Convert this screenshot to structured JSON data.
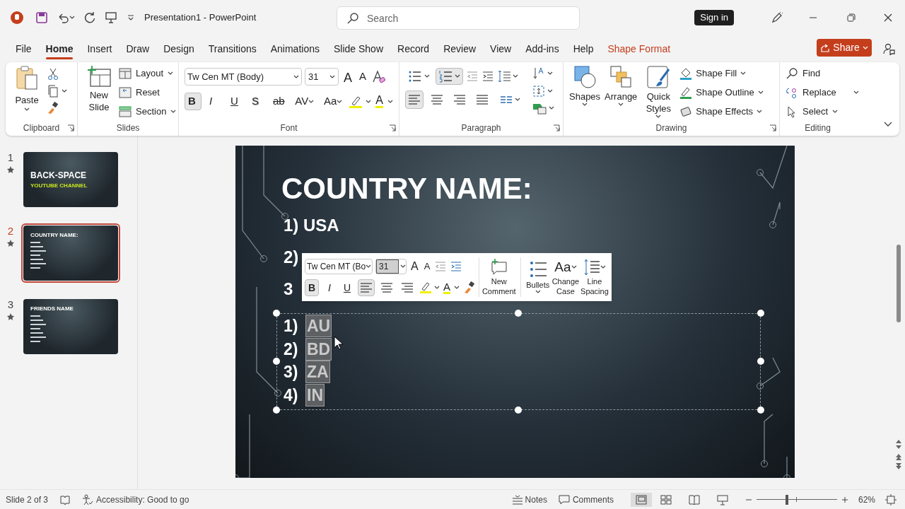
{
  "title_bar": {
    "document_title": "Presentation1  -  PowerPoint",
    "search": {
      "placeholder": "Search"
    },
    "sign_in": "Sign in"
  },
  "menu_tabs": [
    {
      "label": "File",
      "selected": false,
      "kind": "normal"
    },
    {
      "label": "Home",
      "selected": true,
      "kind": "normal"
    },
    {
      "label": "Insert",
      "selected": false,
      "kind": "normal"
    },
    {
      "label": "Draw",
      "selected": false,
      "kind": "normal"
    },
    {
      "label": "Design",
      "selected": false,
      "kind": "normal"
    },
    {
      "label": "Transitions",
      "selected": false,
      "kind": "normal"
    },
    {
      "label": "Animations",
      "selected": false,
      "kind": "normal"
    },
    {
      "label": "Slide Show",
      "selected": false,
      "kind": "normal"
    },
    {
      "label": "Record",
      "selected": false,
      "kind": "normal"
    },
    {
      "label": "Review",
      "selected": false,
      "kind": "normal"
    },
    {
      "label": "View",
      "selected": false,
      "kind": "normal"
    },
    {
      "label": "Add-ins",
      "selected": false,
      "kind": "normal"
    },
    {
      "label": "Help",
      "selected": false,
      "kind": "normal"
    },
    {
      "label": "Shape Format",
      "selected": false,
      "kind": "contextual"
    }
  ],
  "share": "Share",
  "ribbon": {
    "clipboard": {
      "paste": "Paste",
      "label": "Clipboard"
    },
    "slides": {
      "new_slide": "New Slide",
      "layout": "Layout",
      "reset": "Reset",
      "section": "Section",
      "label": "Slides"
    },
    "font": {
      "font_name": "Tw Cen MT (Body)",
      "font_size": "31",
      "grow": "A",
      "shrink": "A",
      "font_color": "A",
      "label": "Font",
      "styles": [
        {
          "glyph": "B",
          "kind": "bold",
          "selected": true
        },
        {
          "glyph": "I",
          "kind": "italic",
          "selected": false
        },
        {
          "glyph": "U",
          "kind": "underline",
          "selected": false
        },
        {
          "glyph": "S",
          "kind": "shadow",
          "selected": false
        },
        {
          "glyph": "ab",
          "kind": "strike",
          "selected": false
        },
        {
          "glyph": "AV",
          "kind": "spacing",
          "selected": false
        },
        {
          "glyph": "Aa",
          "kind": "case",
          "selected": false
        }
      ]
    },
    "paragraph": {
      "label": "Paragraph",
      "list_buttons": [
        {
          "kind": "bullets",
          "selected": false
        },
        {
          "kind": "numbering",
          "selected": true
        }
      ],
      "align": [
        {
          "kind": "left",
          "selected": true
        },
        {
          "kind": "center",
          "selected": false
        },
        {
          "kind": "right",
          "selected": false
        },
        {
          "kind": "justify",
          "selected": false
        }
      ]
    },
    "drawing": {
      "shapes": "Shapes",
      "arrange": "Arrange",
      "quick_styles": "Quick Styles",
      "fill": "Shape Fill",
      "outline": "Shape Outline",
      "effects": "Shape Effects",
      "label": "Drawing"
    },
    "editing": {
      "find": "Find",
      "replace": "Replace",
      "select": "Select",
      "label": "Editing"
    }
  },
  "slides_panel": [
    {
      "number": "1",
      "selected": false,
      "kind": "title",
      "title": "BACK-SPACE",
      "subtitle": "YOUTUBE CHANNEL"
    },
    {
      "number": "2",
      "selected": true,
      "kind": "list",
      "title": "COUNTRY NAME:"
    },
    {
      "number": "3",
      "selected": false,
      "kind": "list",
      "title": "FRIENDS NAME"
    }
  ],
  "slide": {
    "title": "COUNTRY NAME:",
    "lines": [
      "1) USA",
      "2)",
      "3"
    ],
    "selected_list": [
      {
        "number": "1)",
        "code": "AU",
        "selected": true
      },
      {
        "number": "2)",
        "code": "BD",
        "selected": true
      },
      {
        "number": "3)",
        "code": "ZA",
        "selected": true
      },
      {
        "number": "4)",
        "code": "IN",
        "selected": true
      }
    ]
  },
  "mini_toolbar": {
    "font_name": "Tw Cen MT (Bo",
    "font_size": "31",
    "grow": "A",
    "shrink": "A",
    "font_color": "A",
    "styles": [
      {
        "glyph": "B",
        "kind": "bold",
        "selected": true
      },
      {
        "glyph": "I",
        "kind": "italic",
        "selected": false
      },
      {
        "glyph": "U",
        "kind": "underline",
        "selected": false
      }
    ],
    "align": [
      {
        "kind": "left",
        "selected": true
      },
      {
        "kind": "center",
        "selected": false
      },
      {
        "kind": "right",
        "selected": false
      }
    ],
    "new_comment": "New Comment",
    "bullets": "Bullets",
    "change_case_glyph": "Aa",
    "change_case": "Change Case",
    "line_spacing": "Line Spacing"
  },
  "status_bar": {
    "slide_position": "Slide 2 of 3",
    "accessibility": "Accessibility: Good to go",
    "notes": "Notes",
    "comments": "Comments",
    "zoom": {
      "level": 0.37
    },
    "zoom_percent": "62%"
  }
}
